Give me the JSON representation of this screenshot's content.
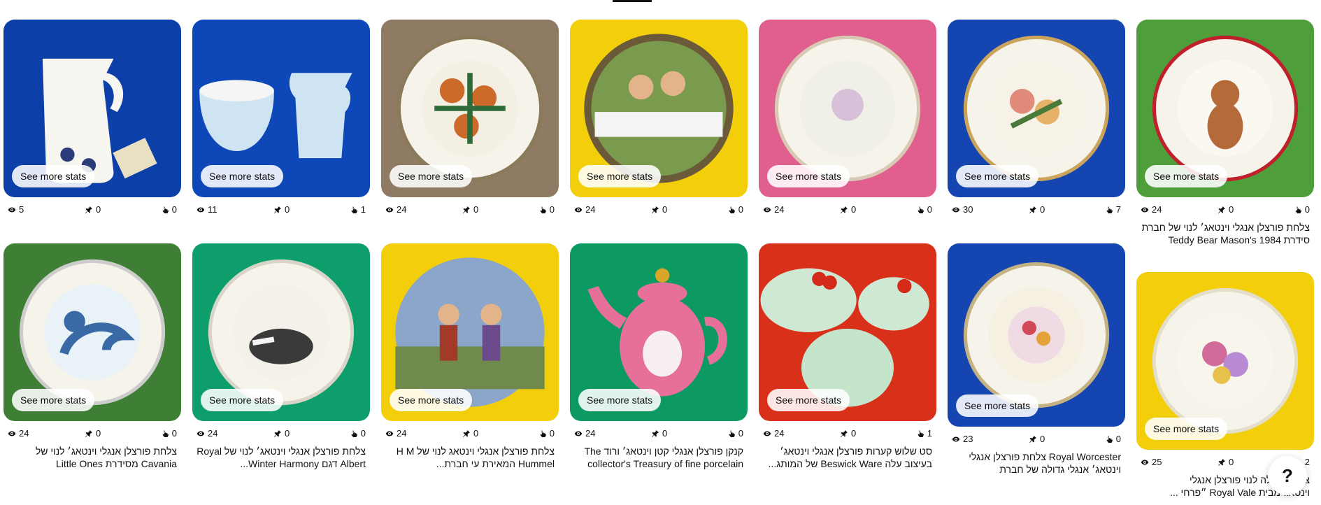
{
  "stats_button_label": "See more stats",
  "help_button_label": "?",
  "icons": {
    "views": "eye-icon",
    "saves": "pin-icon",
    "clicks": "outbound-click-icon"
  },
  "pins": [
    {
      "views": "5",
      "saves": "0",
      "clicks": "0",
      "title": "",
      "bg": "#0d3fa8",
      "subject": "jug"
    },
    {
      "views": "11",
      "saves": "0",
      "clicks": "1",
      "title": "",
      "bg": "#0e47b8",
      "subject": "bowl-jug"
    },
    {
      "views": "24",
      "saves": "0",
      "clicks": "0",
      "title": "",
      "bg": "#8f7a63",
      "subject": "plate-flowers"
    },
    {
      "views": "24",
      "saves": "0",
      "clicks": "0",
      "title": "",
      "bg": "#f2cf0a",
      "subject": "plate-children"
    },
    {
      "views": "24",
      "saves": "0",
      "clicks": "0",
      "title": "",
      "bg": "#e05f8e",
      "subject": "plate-pink"
    },
    {
      "views": "30",
      "saves": "0",
      "clicks": "7",
      "title": "",
      "bg": "#1445b0",
      "subject": "plate-floral"
    },
    {
      "views": "24",
      "saves": "0",
      "clicks": "0",
      "title": "צלחת פורצלן אנגלי וינטאג׳ לנוי של חברת סידרת Teddy Bear Mason's 1984",
      "bg": "#4e9e3c",
      "subject": "plate-teddy"
    },
    {
      "views": "24",
      "saves": "0",
      "clicks": "0",
      "title": "צלחת פורצלן אנגלי וינטאג׳ לנוי של Cavania מסידרת Little Ones",
      "bg": "#3e7e35",
      "subject": "plate-horse"
    },
    {
      "views": "24",
      "saves": "0",
      "clicks": "0",
      "title": "צלחת פורצלן אנגלי וינטאג׳ לנוי של Royal Albert דגם Winter Harmony...",
      "bg": "#0d9e6c",
      "subject": "plate-badger"
    },
    {
      "views": "24",
      "saves": "0",
      "clicks": "0",
      "title": "צלחת פורצלן אנגלי וינטאג לנוי של H M Hummel המאירת עי חברת...",
      "bg": "#f2cf0a",
      "subject": "plate-hummel"
    },
    {
      "views": "24",
      "saves": "0",
      "clicks": "0",
      "title": "קנקן פורצלן אנגלי קטן וינטאג׳ ורוד The collector's Treasury of fine porcelain",
      "bg": "#0c9a62",
      "subject": "teapot"
    },
    {
      "views": "24",
      "saves": "0",
      "clicks": "1",
      "title": "סט שלוש קערות פורצלן אנגלי וינטאג׳ בעיצוב עלה Beswick Ware של המותג...",
      "bg": "#d9301a",
      "subject": "leaf-bowls"
    },
    {
      "views": "23",
      "saves": "0",
      "clicks": "0",
      "title": "Royal Worcester צלחת פורצלן אנגלי וינטאג׳ אנגלי גדולה של חברת",
      "bg": "#1445b0",
      "subject": "plate-worcester"
    },
    {
      "views": "25",
      "saves": "0",
      "clicks": "2",
      "title": "צלחת גדולה לנוי פורצלן אנגלי וינטאג׳מבית Royal Vale ״פרחי ...",
      "bg": "#f2cf0a",
      "subject": "plate-lilies"
    }
  ]
}
